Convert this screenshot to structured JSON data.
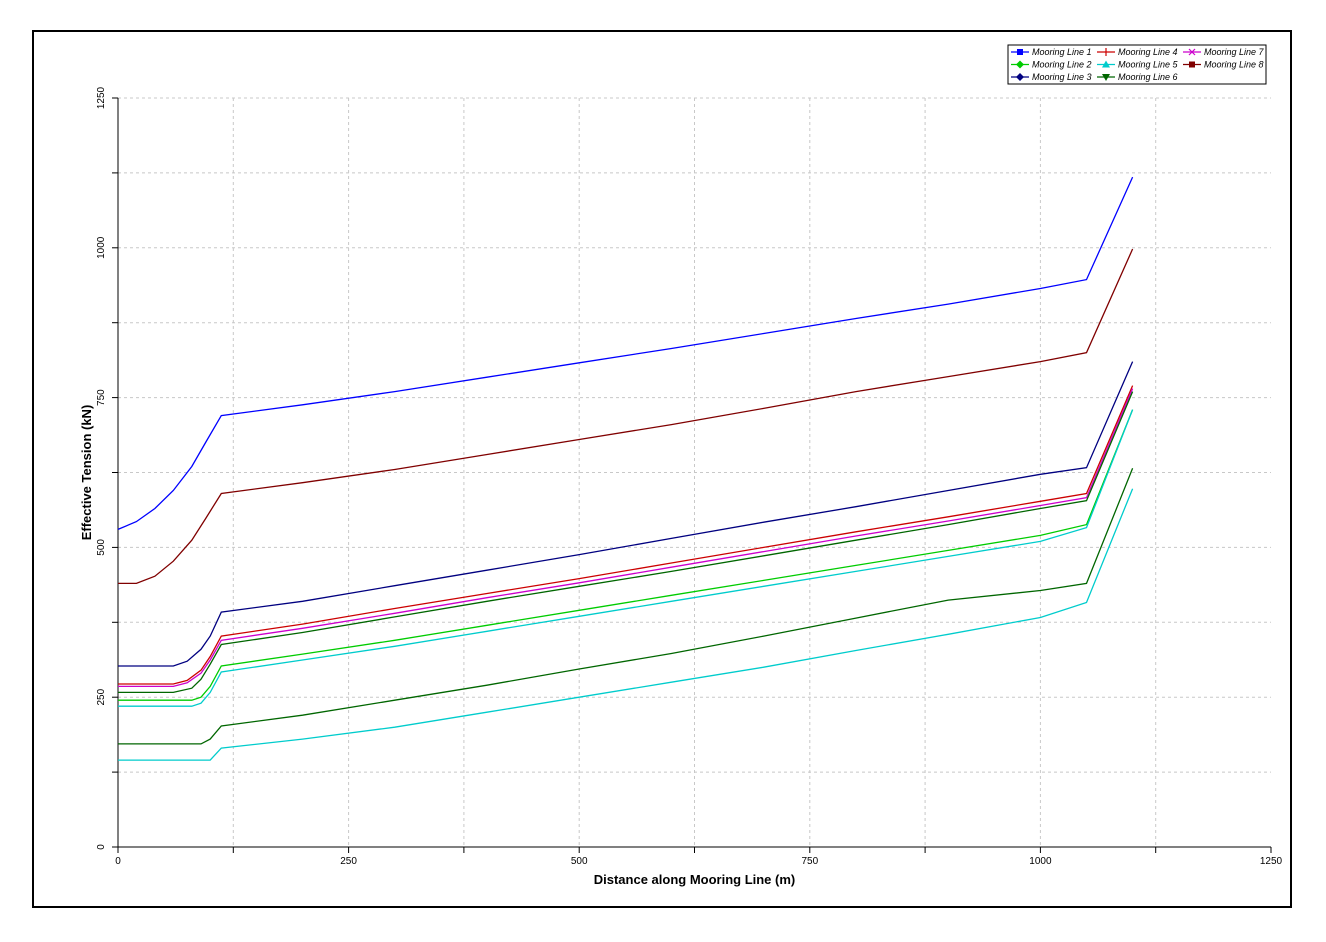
{
  "chart_data": {
    "type": "line",
    "title": "",
    "xlabel": "Distance along Mooring Line (m)",
    "ylabel": "Effective Tension (kN)",
    "xlim": [
      0,
      1250
    ],
    "ylim": [
      0,
      1250
    ],
    "xticks": [
      0,
      250,
      500,
      750,
      1000,
      1250
    ],
    "yticks": [
      0,
      250,
      500,
      750,
      1000,
      1250
    ],
    "grid": true,
    "legend_position": "top-right",
    "series": [
      {
        "name": "Mooring Line 1",
        "color": "#0000ff",
        "marker": "square",
        "x": [
          0,
          20,
          40,
          60,
          80,
          95,
          112,
          200,
          300,
          400,
          500,
          600,
          700,
          800,
          900,
          1000,
          1050,
          1100
        ],
        "y": [
          530,
          543,
          565,
          595,
          635,
          675,
          720,
          738,
          760,
          784,
          808,
          832,
          857,
          882,
          906,
          932,
          947,
          1118
        ]
      },
      {
        "name": "Mooring Line 2",
        "color": "#00cc00",
        "marker": "diamond",
        "x": [
          0,
          80,
          90,
          100,
          112,
          200,
          300,
          400,
          500,
          600,
          700,
          800,
          900,
          1000,
          1050,
          1100
        ],
        "y": [
          245,
          245,
          250,
          268,
          302,
          322,
          345,
          370,
          395,
          420,
          445,
          470,
          495,
          520,
          538,
          730
        ]
      },
      {
        "name": "Mooring Line 3",
        "color": "#000080",
        "marker": "diamond",
        "x": [
          0,
          60,
          75,
          90,
          100,
          112,
          200,
          300,
          400,
          500,
          600,
          700,
          800,
          900,
          1000,
          1050,
          1100
        ],
        "y": [
          302,
          302,
          310,
          330,
          352,
          392,
          410,
          436,
          462,
          488,
          515,
          542,
          568,
          595,
          622,
          633,
          810
        ]
      },
      {
        "name": "Mooring Line 4",
        "color": "#cc0000",
        "marker": "plus",
        "x": [
          0,
          60,
          75,
          90,
          100,
          112,
          200,
          300,
          400,
          500,
          600,
          700,
          800,
          900,
          1000,
          1050,
          1100
        ],
        "y": [
          272,
          272,
          278,
          295,
          318,
          352,
          372,
          398,
          423,
          448,
          474,
          500,
          526,
          551,
          577,
          590,
          770
        ]
      },
      {
        "name": "Mooring Line 5",
        "color": "#00cccc",
        "marker": "triangle-up",
        "x": [
          0,
          80,
          90,
          100,
          112,
          200,
          300,
          400,
          500,
          600,
          700,
          800,
          900,
          1000,
          1050,
          1100
        ],
        "y": [
          235,
          235,
          240,
          258,
          292,
          312,
          335,
          360,
          385,
          410,
          435,
          460,
          485,
          510,
          533,
          730
        ]
      },
      {
        "name": "Mooring Line 6",
        "color": "#006600",
        "marker": "triangle-down",
        "x": [
          0,
          90,
          100,
          112,
          200,
          300,
          400,
          500,
          600,
          700,
          800,
          900,
          1000,
          1050,
          1100
        ],
        "y": [
          172,
          172,
          180,
          202,
          220,
          245,
          270,
          297,
          323,
          352,
          382,
          412,
          428,
          440,
          632
        ]
      },
      {
        "name": "Mooring Line 7",
        "color": "#cc00cc",
        "marker": "cross",
        "x": [
          0,
          60,
          75,
          90,
          100,
          112,
          200,
          300,
          400,
          500,
          600,
          700,
          800,
          900,
          1000,
          1050,
          1100
        ],
        "y": [
          268,
          268,
          274,
          290,
          312,
          345,
          365,
          390,
          416,
          441,
          467,
          493,
          519,
          544,
          570,
          583,
          765
        ]
      },
      {
        "name": "Mooring Line 8",
        "color": "#800000",
        "marker": "square",
        "x": [
          0,
          20,
          40,
          60,
          80,
          95,
          112,
          200,
          300,
          400,
          500,
          600,
          700,
          800,
          900,
          1000,
          1050,
          1100
        ],
        "y": [
          440,
          440,
          452,
          477,
          512,
          548,
          590,
          608,
          630,
          655,
          680,
          705,
          732,
          760,
          785,
          810,
          825,
          998
        ]
      },
      {
        "name": "",
        "color": "#00cccc",
        "marker": "none",
        "x": [
          0,
          100,
          112,
          200,
          300,
          400,
          500,
          600,
          700,
          800,
          900,
          1000,
          1050,
          1100
        ],
        "y": [
          145,
          145,
          165,
          180,
          200,
          225,
          250,
          275,
          300,
          328,
          355,
          383,
          408,
          598
        ]
      },
      {
        "name": "",
        "color": "#006600",
        "marker": "none",
        "x": [
          0,
          60,
          80,
          90,
          100,
          112,
          200,
          300,
          400,
          500,
          600,
          700,
          800,
          900,
          1000,
          1050,
          1100
        ],
        "y": [
          258,
          258,
          265,
          280,
          305,
          338,
          358,
          384,
          410,
          435,
          460,
          486,
          512,
          538,
          565,
          578,
          760
        ]
      }
    ]
  }
}
